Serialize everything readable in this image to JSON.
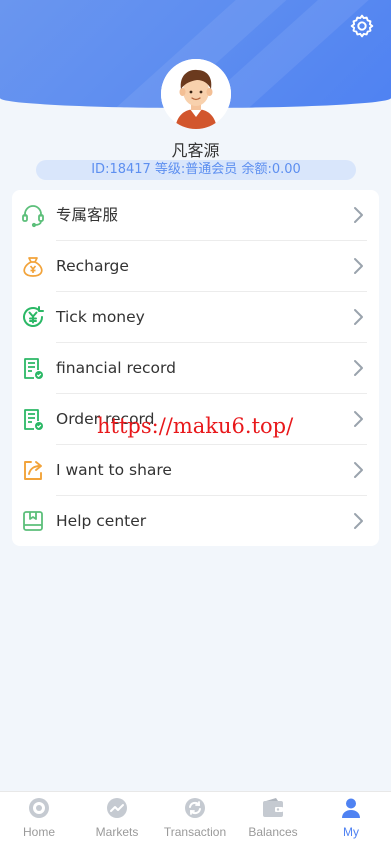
{
  "profile": {
    "name": "凡客源",
    "info": "ID:18417  等级:普通会员  余额:0.00"
  },
  "menu": [
    {
      "label": "专属客服",
      "icon": "headset-icon",
      "color": "#5cbf7a"
    },
    {
      "label": "Recharge",
      "icon": "money-bag-icon",
      "color": "#f2a33a"
    },
    {
      "label": "Tick money",
      "icon": "yen-coin-icon",
      "color": "#2bb866"
    },
    {
      "label": "financial record",
      "icon": "document-check-icon",
      "color": "#2bb866"
    },
    {
      "label": "Order record",
      "icon": "document-check-icon",
      "color": "#2bb866"
    },
    {
      "label": "I want to share",
      "icon": "share-icon",
      "color": "#f2a33a"
    },
    {
      "label": "Help center",
      "icon": "book-icon",
      "color": "#5cbf7a"
    }
  ],
  "watermark": "https://maku6.top/",
  "tabs": [
    {
      "label": "Home",
      "icon": "home-icon"
    },
    {
      "label": "Markets",
      "icon": "markets-icon"
    },
    {
      "label": "Transaction",
      "icon": "transaction-icon"
    },
    {
      "label": "Balances",
      "icon": "wallet-icon"
    },
    {
      "label": "My",
      "icon": "user-icon",
      "active": true
    }
  ],
  "colors": {
    "accent": "#4f82f2",
    "inactive": "#9a9a9a"
  }
}
